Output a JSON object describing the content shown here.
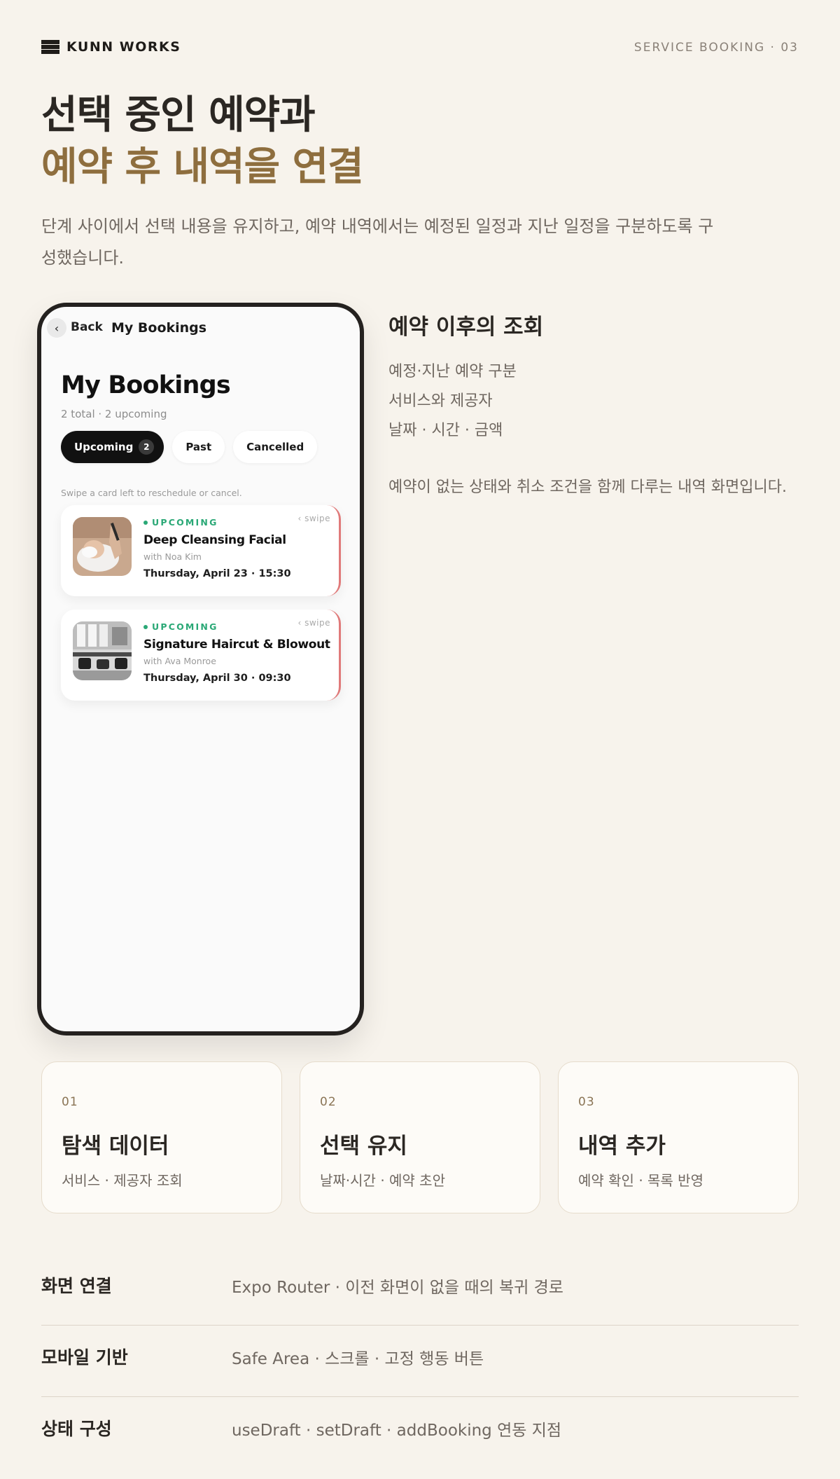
{
  "header": {
    "brand": "KUNN WORKS",
    "section_tag": "SERVICE BOOKING · 03"
  },
  "hero": {
    "title_line1": "선택 중인 예약과",
    "title_line2": "예약 후 내역을 연결",
    "description": "단계 사이에서 선택 내용을 유지하고, 예약 내역에서는 예정된 일정과 지난 일정을 구분하도록 구성했습니다."
  },
  "phone": {
    "nav": {
      "back_label": "Back",
      "title": "My Bookings"
    },
    "page_title": "My Bookings",
    "summary": "2 total · 2 upcoming",
    "tabs": [
      {
        "label": "Upcoming",
        "count": "2",
        "active": true
      },
      {
        "label": "Past",
        "active": false
      },
      {
        "label": "Cancelled",
        "active": false
      }
    ],
    "hint": "Swipe a card left to reschedule or cancel.",
    "bookings": [
      {
        "status": "UPCOMING",
        "swipe": "‹ swipe",
        "service": "Deep Cleansing Facial",
        "provider": "with Noa Kim",
        "when": "Thursday, April 23 · 15:30",
        "image": "facial-treatment-photo"
      },
      {
        "status": "UPCOMING",
        "swipe": "‹ swipe",
        "service": "Signature Haircut & Blowout",
        "provider": "with Ava Monroe",
        "when": "Thursday, April 30 · 09:30",
        "image": "salon-interior-photo"
      }
    ]
  },
  "side": {
    "title": "예약 이후의 조회",
    "items": [
      "예정·지난 예약 구분",
      "서비스와 제공자",
      "날짜 · 시간 · 금액"
    ],
    "note": "예약이 없는 상태와 취소 조건을 함께 다루는 내역 화면입니다."
  },
  "steps": [
    {
      "num": "01",
      "title": "탐색 데이터",
      "desc": "서비스 · 제공자 조회"
    },
    {
      "num": "02",
      "title": "선택 유지",
      "desc": "날짜·시간 · 예약 초안"
    },
    {
      "num": "03",
      "title": "내역 추가",
      "desc": "예약 확인 · 목록 반영"
    }
  ],
  "info": [
    {
      "key": "화면 연결",
      "value": "Expo Router · 이전 화면이 없을 때의 복귀 경로"
    },
    {
      "key": "모바일 기반",
      "value": "Safe Area · 스크롤 · 고정 행동 버튼"
    },
    {
      "key": "상태 구성",
      "value": "useDraft · setDraft · addBooking 연동 지점"
    }
  ],
  "colors": {
    "background": "#f7f3ec",
    "accent_gold": "#8e6e3e",
    "status_green": "#2aa876",
    "swipe_edge_red": "#e07a7a"
  }
}
